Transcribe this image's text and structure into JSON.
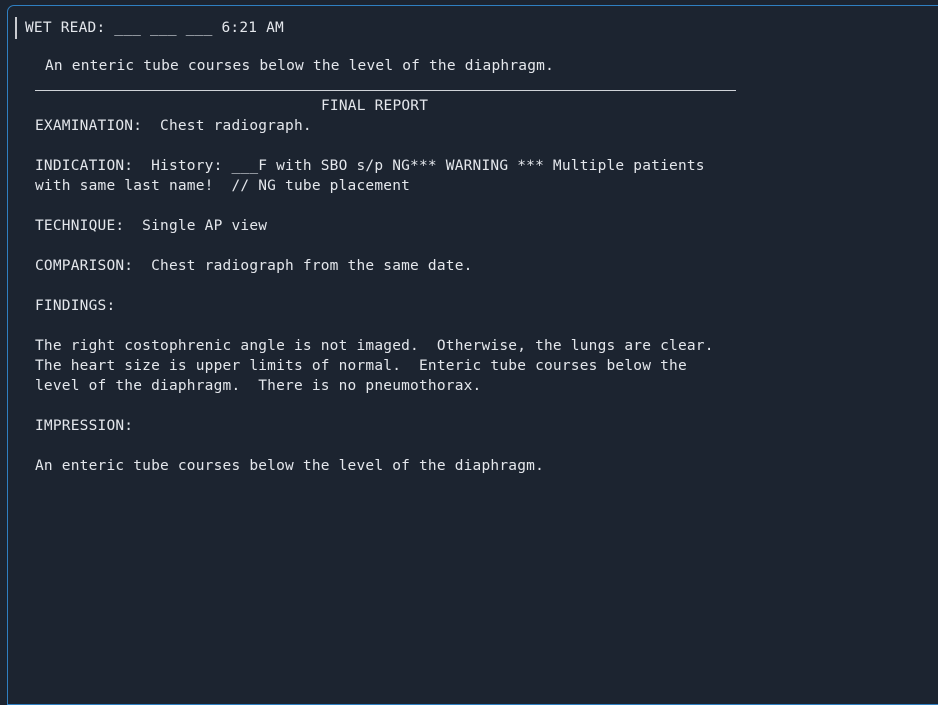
{
  "panel": {
    "border_color": "#2f7fc1",
    "background_color": "#1c2430",
    "text_color": "#e4e7ec"
  },
  "wet_read": {
    "label_line": "WET READ: ___ ___ ___ 6:21 AM",
    "summary": "An enteric tube courses below the level of the diaphragm."
  },
  "divider": {
    "color": "#cfd3d8"
  },
  "final_report": {
    "title": "FINAL REPORT",
    "sections": [
      {
        "name": "examination",
        "lines": [
          "EXAMINATION:  Chest radiograph."
        ]
      },
      {
        "name": "indication",
        "lines": [
          "INDICATION:  History: ___F with SBO s/p NG*** WARNING *** Multiple patients",
          "with same last name!  // NG tube placement"
        ]
      },
      {
        "name": "technique",
        "lines": [
          "TECHNIQUE:  Single AP view"
        ]
      },
      {
        "name": "comparison",
        "lines": [
          "COMPARISON:  Chest radiograph from the same date."
        ]
      },
      {
        "name": "findings-heading",
        "lines": [
          "FINDINGS:"
        ]
      },
      {
        "name": "findings-body",
        "lines": [
          "The right costophrenic angle is not imaged.  Otherwise, the lungs are clear.",
          "The heart size is upper limits of normal.  Enteric tube courses below the",
          "level of the diaphragm.  There is no pneumothorax."
        ]
      },
      {
        "name": "impression-heading",
        "lines": [
          "IMPRESSION:"
        ]
      },
      {
        "name": "impression-body",
        "lines": [
          "An enteric tube courses below the level of the diaphragm."
        ]
      }
    ]
  }
}
